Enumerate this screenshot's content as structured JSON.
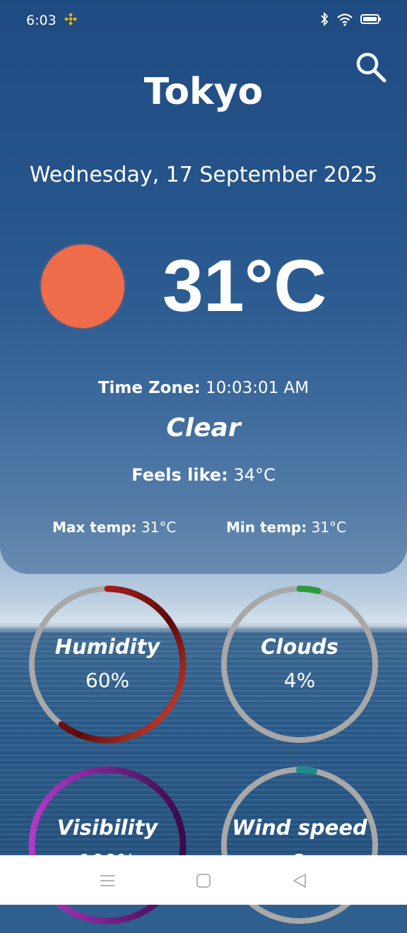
{
  "status_bar": {
    "time": "6:03",
    "icons": [
      "binance-icon",
      "bluetooth-icon",
      "wifi-icon",
      "battery-icon"
    ]
  },
  "header": {
    "city": "Tokyo",
    "date": "Wednesday, 17 September 2025",
    "search_icon": "search-icon"
  },
  "current": {
    "temperature": "31°C",
    "weather_icon": "sun-icon",
    "time_zone_label": "Time Zone:",
    "time_zone_value": "10:03:01 AM",
    "condition": "Clear",
    "feels_like_label": "Feels like:",
    "feels_like_value": "34°C",
    "max_label": "Max temp:",
    "max_value": "31°C",
    "min_label": "Min temp:",
    "min_value": "31°C"
  },
  "gauges": [
    {
      "label": "Humidity",
      "value": "60%",
      "fraction": 0.6
    },
    {
      "label": "Clouds",
      "value": "4%",
      "fraction": 0.04
    },
    {
      "label": "Visibility",
      "value": "100%",
      "fraction": 1.0
    },
    {
      "label": "Wind speed",
      "value": "3",
      "fraction": 0.03
    }
  ],
  "colors": {
    "sun": "#ef6c4a",
    "humidity_arc": "#b52020",
    "clouds_arc": "#2e9a3a",
    "visibility_arc": "#9c27b0",
    "wind_arc": "#1f8a8a",
    "track": "#a8a8a8"
  },
  "nav": [
    "menu-icon",
    "home-icon",
    "back-icon"
  ]
}
